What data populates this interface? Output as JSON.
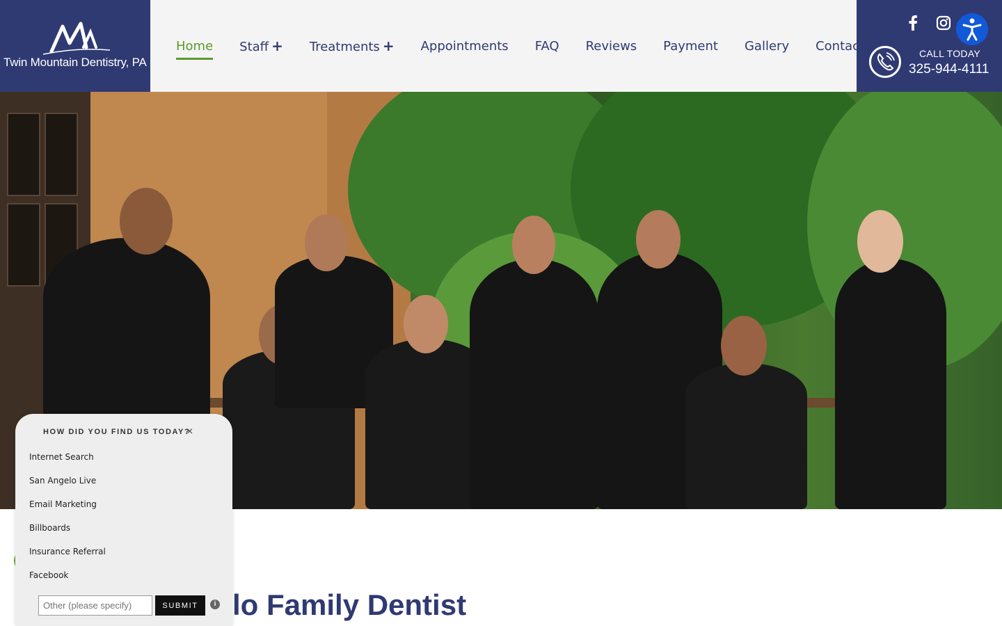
{
  "brand": {
    "logo_text": "Twin Mountain Dentistry, PA",
    "primary_color": "#2f3a73",
    "accent_color": "#5a9a2a"
  },
  "nav": {
    "items": [
      {
        "label": "Home",
        "active": true
      },
      {
        "label": "Staff",
        "expandable": true
      },
      {
        "label": "Treatments",
        "expandable": true
      },
      {
        "label": "Appointments"
      },
      {
        "label": "FAQ"
      },
      {
        "label": "Reviews"
      },
      {
        "label": "Payment"
      },
      {
        "label": "Gallery"
      },
      {
        "label": "Contact"
      }
    ],
    "plus_symbol": "+"
  },
  "contact": {
    "call_label": "CALL TODAY",
    "phone": "325-944-4111",
    "social_icons": [
      "facebook-icon",
      "instagram-icon"
    ],
    "accessibility_icon": "accessibility-icon"
  },
  "hero": {
    "image_description_icon": "team-photo"
  },
  "main": {
    "heading": "lo Family Dentist"
  },
  "survey": {
    "title": "HOW DID YOU FIND US TODAY?",
    "close": "×",
    "options": [
      "Internet Search",
      "San Angelo Live",
      "Email Marketing",
      "Billboards",
      "Insurance Referral",
      "Facebook"
    ],
    "other_placeholder": "Other (please specify)",
    "submit_label": "SUBMIT",
    "info": "i"
  }
}
